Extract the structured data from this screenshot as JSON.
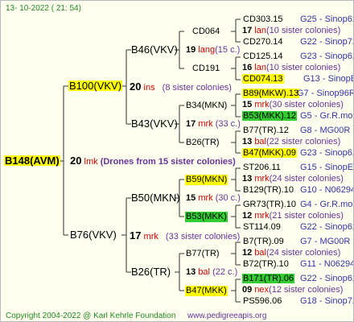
{
  "header": {
    "date": "13- 10-2022 ( 21: 54)"
  },
  "footer": {
    "copyright": "Copyright 2004-2022 @ Karl Kehrle Foundation",
    "url": "www.pedigreeapis.org"
  },
  "root": {
    "label": "B148(AVM)",
    "count": "20",
    "abbr": "lmk",
    "note": "(Drones from 15 sister colonies)"
  },
  "g1": [
    {
      "label": "B100(VKV)",
      "count": "20",
      "abbr": "ins",
      "note": "(8 sister colonies)"
    },
    {
      "label": "B76(VKV)",
      "count": "17",
      "abbr": "mrk",
      "note": "(33 sister colonies)"
    }
  ],
  "g2": [
    {
      "label": "B46(VKV)",
      "count": "19",
      "abbr": "lang",
      "note": "(15 c.)"
    },
    {
      "label": "B43(VKV)",
      "count": "17",
      "abbr": "mrk",
      "note": "(33 c.)"
    },
    {
      "label": "B50(MKN)",
      "count": "15",
      "abbr": "mrk",
      "note": "(30 c.)"
    },
    {
      "label": "B26(TR)",
      "count": "13",
      "abbr": "bal",
      "note": "(22 c.)"
    }
  ],
  "g3": [
    {
      "label": "CD064",
      "count": "17",
      "abbr": "lan",
      "note": "(10 sister colonies)",
      "left": "CD303.15",
      "left_code": "G25 - Sinop62R",
      "right": "CD270.14",
      "right_code": "G22 - Sinop72R"
    },
    {
      "label": "CD191",
      "count": "16",
      "abbr": "lan",
      "note": "(10 sister colonies)",
      "left": "CD125.14",
      "left_code": "G23 - Sinop62R",
      "right": "CD074.13",
      "right_code": "G13 - SinopEgg86R"
    },
    {
      "label": "B34(MKN)",
      "count": "15",
      "abbr": "mrk",
      "note": "(30 sister colonies)",
      "left": "B89(MKW).13",
      "left_code": "G7 - Sinop96R",
      "right": "B53(MKK).12",
      "right_code": "G5 - Gr.R.mounta"
    },
    {
      "label": "B26(TR)",
      "count": "13",
      "abbr": "bal",
      "note": "(22 sister colonies)",
      "left": "B77(TR).12",
      "left_code": "G8 - MG00R",
      "right": "B47(MKK).09",
      "right_code": "G23 - Sinop62R"
    },
    {
      "label": "B59(MKN)",
      "count": "13",
      "abbr": "mrk",
      "note": "(24 sister colonies)",
      "left": "ST206.11",
      "left_code": "G15 - SinopEgg86R",
      "right": "B129(TR).10",
      "right_code": "G10 - N06294R"
    },
    {
      "label": "B53(MKK)",
      "count": "12",
      "abbr": "mrk",
      "note": "(21 sister colonies)",
      "left": "GR73(TR).10",
      "left_code": "G4 - Gr.R.mounta",
      "right": "ST114.09",
      "right_code": "G22 - Sinop62R"
    },
    {
      "label": "B77(TR)",
      "count": "12",
      "abbr": "bal",
      "note": "(24 sister colonies)",
      "left": "B7(TR).09",
      "left_code": "G7 - MG00R",
      "right": "B72(TR).10",
      "right_code": "G11 - N06294R"
    },
    {
      "label": "B47(MKK)",
      "count": "09",
      "abbr": "nex",
      "note": "(12 sister colonies)",
      "left": "B171(TR).06",
      "left_code": "G22 - Sinop62R",
      "right": "PS596.06",
      "right_code": "G18 - Sinop72R"
    }
  ]
}
